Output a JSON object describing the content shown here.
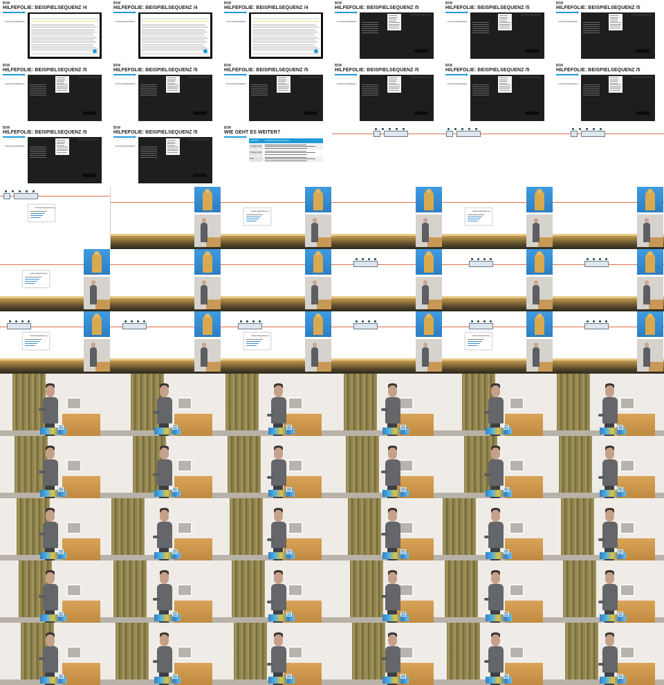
{
  "logo_text": "BIW",
  "slides": {
    "title_seq4": "HILFEFOLIE: BEISPIELSEQUENZ /4",
    "title_seq5": "HILFEFOLIE: BEISPIELSEQUENZ /5",
    "title_next": "WIE GEHT ES WEITER?",
    "subtitle": "Fremde Regelfolation"
  },
  "table": {
    "header_left": "Zeitraum",
    "header_right": "Entwicklungsschwerpunkte",
    "rows": [
      "1. Halbjahr 2025",
      "2. Halbjahr 2025",
      "2026"
    ]
  },
  "timeline": {
    "popup_title": "Zentrale Kategorisierung",
    "popup_title_short": "Lokale Kategorisierung"
  },
  "colors": {
    "accent": "#1e9ad6",
    "timeline_line": "#d97045",
    "field": "#9a7b3e",
    "sky": "#3f9be1",
    "curtain": "#8a7d4a",
    "lectern": "#d9a457"
  }
}
